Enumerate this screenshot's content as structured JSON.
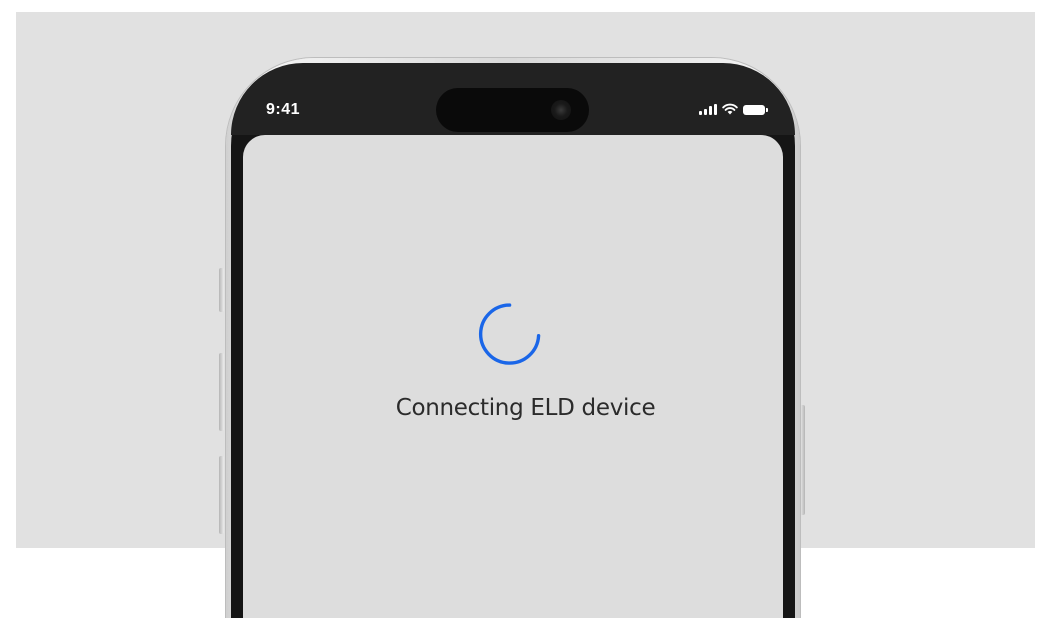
{
  "status_bar": {
    "time": "9:41",
    "icons": [
      "cellular-signal-icon",
      "wifi-icon",
      "battery-icon"
    ]
  },
  "loading": {
    "message": "Connecting ELD device",
    "spinner_icon": "loading-spinner-icon",
    "accent_color": "#1a66e8"
  },
  "colors": {
    "background": "#e1e1e1",
    "screen": "#dddddd",
    "text": "#2b2b2b"
  }
}
